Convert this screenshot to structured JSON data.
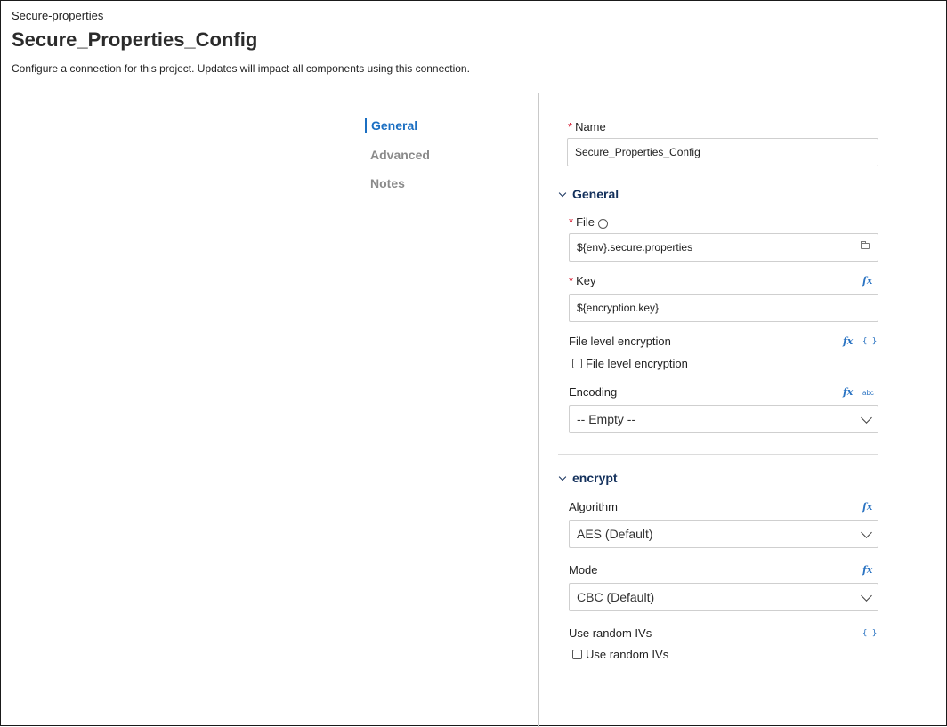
{
  "header": {
    "subtitle": "Secure-properties",
    "title": "Secure_Properties_Config",
    "description": "Configure a connection for this project. Updates will impact all components using this connection."
  },
  "nav": {
    "items": [
      {
        "label": "General",
        "active": true
      },
      {
        "label": "Advanced",
        "active": false
      },
      {
        "label": "Notes",
        "active": false
      }
    ]
  },
  "form": {
    "name": {
      "label": "Name",
      "required": true,
      "value": "Secure_Properties_Config"
    },
    "general_section": {
      "label": "General",
      "expanded": true
    },
    "file": {
      "label": "File",
      "required": true,
      "value": "${env}.secure.properties",
      "icon": "folder-icon",
      "info_icon": "ⓘ"
    },
    "key": {
      "label": "Key",
      "required": true,
      "value": "${encryption.key}",
      "fx": "fx"
    },
    "file_level_encryption": {
      "label": "File level encryption",
      "checkbox_label": "File level encryption",
      "checked": false,
      "fx": "fx",
      "brace": "{ }"
    },
    "encoding": {
      "label": "Encoding",
      "value": "-- Empty --",
      "fx": "fx",
      "abc": "abc"
    },
    "encrypt_section": {
      "label": "encrypt",
      "expanded": true
    },
    "algorithm": {
      "label": "Algorithm",
      "value": "AES (Default)",
      "fx": "fx"
    },
    "mode": {
      "label": "Mode",
      "value": "CBC (Default)",
      "fx": "fx"
    },
    "use_random_ivs": {
      "label": "Use random IVs",
      "checkbox_label": "Use random IVs",
      "checked": false,
      "brace": "{ }"
    }
  },
  "colors": {
    "accent": "#1b6fc2",
    "required": "#d0021b",
    "section_heading": "#14315c"
  }
}
